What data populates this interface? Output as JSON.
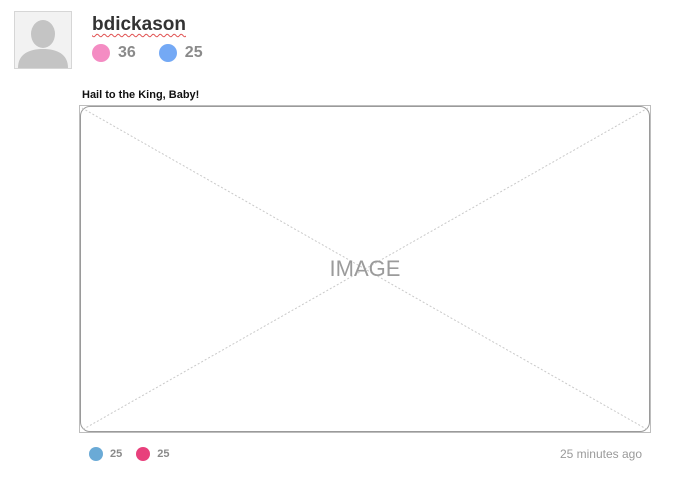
{
  "user": {
    "username": "bdickason",
    "stats": [
      {
        "value": "36",
        "color": "#f48cc3",
        "icon": "pink-dot-icon"
      },
      {
        "value": "25",
        "color": "#74a9f5",
        "icon": "blue-dot-icon"
      }
    ]
  },
  "post": {
    "title": "Hail to the King, Baby!",
    "image_placeholder": "IMAGE",
    "footer_stats": [
      {
        "value": "25",
        "color": "#6aaad6",
        "icon": "blue-dot-icon"
      },
      {
        "value": "25",
        "color": "#e8407c",
        "icon": "pink-dot-icon"
      }
    ],
    "timestamp": "25 minutes ago"
  }
}
